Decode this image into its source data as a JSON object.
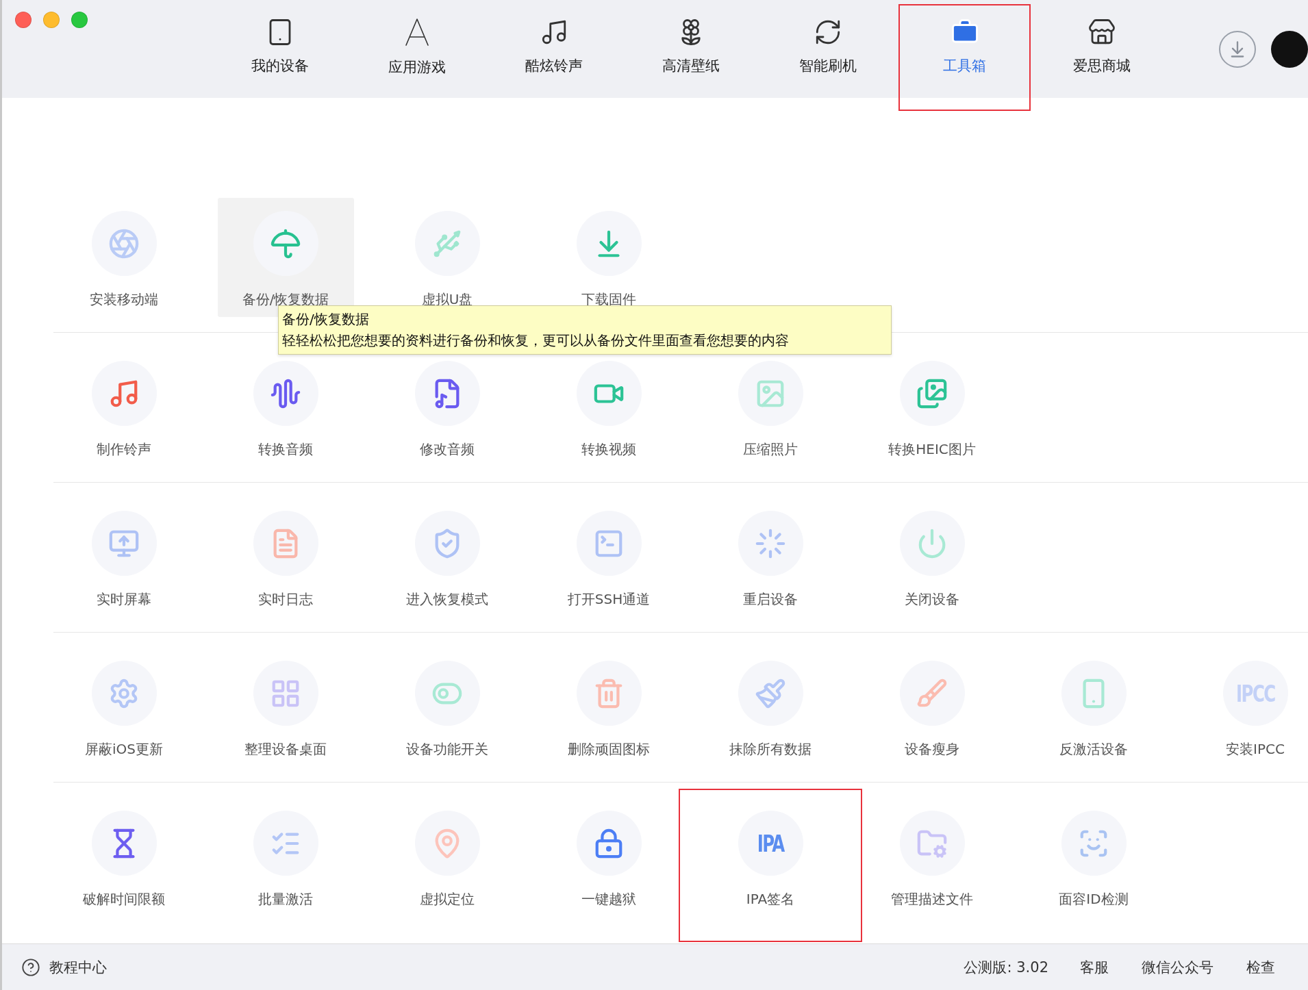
{
  "nav_tabs": [
    {
      "label": "我的设备",
      "selected": false,
      "annotated": false
    },
    {
      "label": "应用游戏",
      "selected": false,
      "annotated": false
    },
    {
      "label": "酷炫铃声",
      "selected": false,
      "annotated": false
    },
    {
      "label": "高清壁纸",
      "selected": false,
      "annotated": false
    },
    {
      "label": "智能刷机",
      "selected": false,
      "annotated": false
    },
    {
      "label": "工具箱",
      "selected": true,
      "annotated": true
    },
    {
      "label": "爱思商城",
      "selected": false,
      "annotated": false
    }
  ],
  "tool_rows": [
    {
      "tools": [
        {
          "label": "安装移动端",
          "color": "#b9cbf6",
          "highlighted": false,
          "annotated": false
        },
        {
          "label": "备份/恢复数据",
          "color": "#27c190",
          "highlighted": true,
          "annotated": false
        },
        {
          "label": "虚拟U盘",
          "color": "#9fe6cf",
          "highlighted": false,
          "annotated": false
        },
        {
          "label": "下载固件",
          "color": "#2cc395",
          "highlighted": false,
          "annotated": false
        }
      ]
    },
    {
      "tools": [
        {
          "label": "制作铃声",
          "color": "#f25c4a",
          "highlighted": false,
          "annotated": false
        },
        {
          "label": "转换音频",
          "color": "#6a5bf0",
          "highlighted": false,
          "annotated": false
        },
        {
          "label": "修改音频",
          "color": "#6a5bf0",
          "highlighted": false,
          "annotated": false
        },
        {
          "label": "转换视频",
          "color": "#2cc395",
          "highlighted": false,
          "annotated": false
        },
        {
          "label": "压缩照片",
          "color": "#a8e9d4",
          "highlighted": false,
          "annotated": false
        },
        {
          "label": "转换HEIC图片",
          "color": "#2cc395",
          "highlighted": false,
          "annotated": false
        }
      ]
    },
    {
      "tools": [
        {
          "label": "实时屏幕",
          "color": "#aec2f5",
          "highlighted": false,
          "annotated": false
        },
        {
          "label": "实时日志",
          "color": "#f9b7ab",
          "highlighted": false,
          "annotated": false
        },
        {
          "label": "进入恢复模式",
          "color": "#aec2f5",
          "highlighted": false,
          "annotated": false
        },
        {
          "label": "打开SSH通道",
          "color": "#aec2f5",
          "highlighted": false,
          "annotated": false
        },
        {
          "label": "重启设备",
          "color": "#aec2f5",
          "highlighted": false,
          "annotated": false
        },
        {
          "label": "关闭设备",
          "color": "#a8e9d4",
          "highlighted": false,
          "annotated": false
        }
      ]
    },
    {
      "tools": [
        {
          "label": "屏蔽iOS更新",
          "color": "#b3c6f6",
          "highlighted": false,
          "annotated": false
        },
        {
          "label": "整理设备桌面",
          "color": "#c9c3f7",
          "highlighted": false,
          "annotated": false
        },
        {
          "label": "设备功能开关",
          "color": "#a8e9d4",
          "highlighted": false,
          "annotated": false
        },
        {
          "label": "删除顽固图标",
          "color": "#fbbcb0",
          "highlighted": false,
          "annotated": false
        },
        {
          "label": "抹除所有数据",
          "color": "#b3c6f6",
          "highlighted": false,
          "annotated": false
        },
        {
          "label": "设备瘦身",
          "color": "#fbbcb0",
          "highlighted": false,
          "annotated": false
        },
        {
          "label": "反激活设备",
          "color": "#a8e9d4",
          "highlighted": false,
          "annotated": false
        },
        {
          "label": "安装IPCC",
          "color": "#c3d1f7",
          "highlighted": false,
          "annotated": false,
          "badge": "IPCC"
        }
      ]
    },
    {
      "tools": [
        {
          "label": "破解时间限额",
          "color": "#6d5ef0",
          "highlighted": false,
          "annotated": false
        },
        {
          "label": "批量激活",
          "color": "#b3c6f6",
          "highlighted": false,
          "annotated": false
        },
        {
          "label": "虚拟定位",
          "color": "#fdc4bb",
          "highlighted": false,
          "annotated": false
        },
        {
          "label": "一键越狱",
          "color": "#4c7ef5",
          "highlighted": false,
          "annotated": false
        },
        {
          "label": "IPA签名",
          "color": "#5b8def",
          "highlighted": false,
          "annotated": true,
          "badge": "IPA"
        },
        {
          "label": "管理描述文件",
          "color": "#c9c3f7",
          "highlighted": false,
          "annotated": false
        },
        {
          "label": "面容ID检测",
          "color": "#a9c3f2",
          "highlighted": false,
          "annotated": false
        }
      ]
    }
  ],
  "tooltip": {
    "title": "备份/恢复数据",
    "description": "轻轻松松把您想要的资料进行备份和恢复，更可以从备份文件里面查看您想要的内容"
  },
  "status_bar": {
    "help": "教程中心",
    "version": "公测版: 3.02",
    "links": [
      "客服",
      "微信公众号",
      "检查"
    ]
  }
}
